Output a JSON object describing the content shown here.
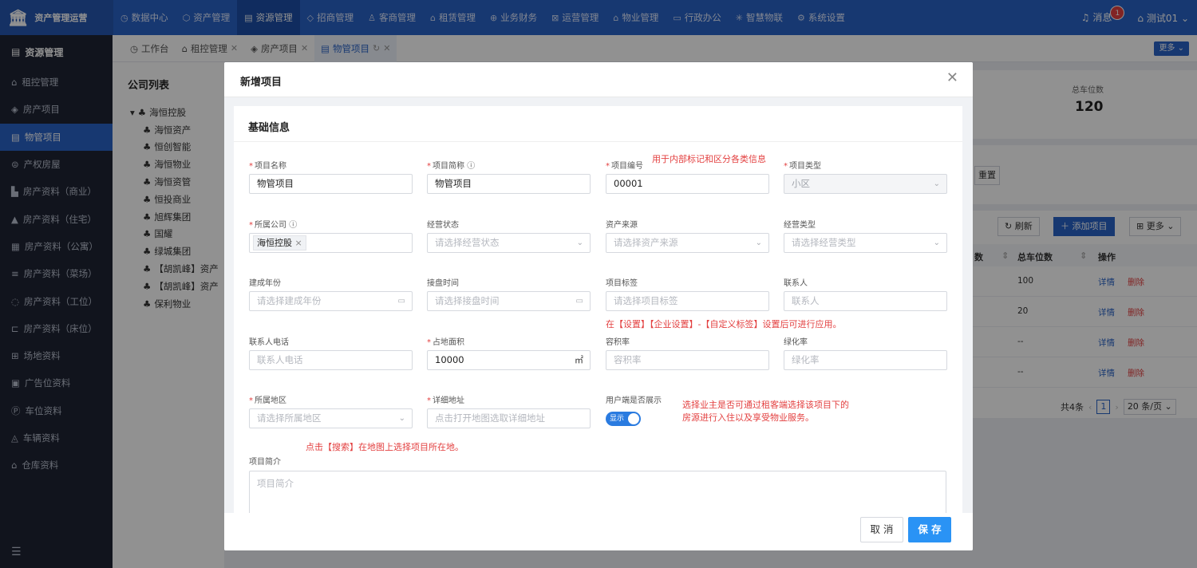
{
  "topbar": {
    "app_name": "资产管理运营",
    "nav": [
      {
        "label": "数据中心",
        "icon": "dashboard-icon",
        "glyph": "◷"
      },
      {
        "label": "资产管理",
        "icon": "cube-icon",
        "glyph": "⬡"
      },
      {
        "label": "资源管理",
        "icon": "document-icon",
        "glyph": "▤"
      },
      {
        "label": "招商管理",
        "icon": "tag-icon",
        "glyph": "◇"
      },
      {
        "label": "客商管理",
        "icon": "users-icon",
        "glyph": "♙"
      },
      {
        "label": "租赁管理",
        "icon": "building-icon",
        "glyph": "⌂"
      },
      {
        "label": "业务财务",
        "icon": "coin-icon",
        "glyph": "⊕"
      },
      {
        "label": "运营管理",
        "icon": "grid-icon",
        "glyph": "⊠"
      },
      {
        "label": "物业管理",
        "icon": "home-icon",
        "glyph": "⌂"
      },
      {
        "label": "行政办公",
        "icon": "monitor-icon",
        "glyph": "▭"
      },
      {
        "label": "智慧物联",
        "icon": "iot-icon",
        "glyph": "✳"
      },
      {
        "label": "系统设置",
        "icon": "gear-icon",
        "glyph": "⚙"
      }
    ],
    "messages_label": "消息",
    "messages_count": "1",
    "user_label": "测试01"
  },
  "sidebar": {
    "header": "资源管理",
    "items": [
      {
        "label": "租控管理",
        "glyph": "⌂"
      },
      {
        "label": "房产项目",
        "glyph": "◈"
      },
      {
        "label": "物管项目",
        "glyph": "▤"
      },
      {
        "label": "产权房屋",
        "glyph": "⊜"
      },
      {
        "label": "房产资料（商业）",
        "glyph": "▙"
      },
      {
        "label": "房产资料（住宅）",
        "glyph": "▲"
      },
      {
        "label": "房产资料（公寓）",
        "glyph": "▦"
      },
      {
        "label": "房产资料（菜场）",
        "glyph": "≡"
      },
      {
        "label": "房产资料（工位）",
        "glyph": "◌"
      },
      {
        "label": "房产资料（床位）",
        "glyph": "⊏"
      },
      {
        "label": "场地资料",
        "glyph": "⊞"
      },
      {
        "label": "广告位资料",
        "glyph": "▣"
      },
      {
        "label": "车位资料",
        "glyph": "Ⓟ"
      },
      {
        "label": "车辆资料",
        "glyph": "◬"
      },
      {
        "label": "仓库资料",
        "glyph": "⌂"
      }
    ]
  },
  "tabs": [
    {
      "label": "工作台",
      "glyph": "◷"
    },
    {
      "label": "租控管理",
      "glyph": "⌂"
    },
    {
      "label": "房产项目",
      "glyph": "◈"
    },
    {
      "label": "物管项目",
      "glyph": "▤"
    }
  ],
  "tabs_more": "更多 ⌄",
  "company": {
    "title": "公司列表",
    "root": "海恒控股",
    "children": [
      "海恒资产",
      "恒创智能",
      "海恒物业",
      "海恒资管",
      "恒投商业",
      "旭辉集团",
      "国耀",
      "绿城集团",
      "【胡凯峰】资产",
      "【胡凯峰】资产",
      "保利物业"
    ]
  },
  "stats": {
    "label": "总车位数",
    "value": "120"
  },
  "reset_label": "重置",
  "table": {
    "refresh": "刷新",
    "add": "添加项目",
    "more": "更多",
    "col_partial": "数",
    "col_total_parking": "总车位数",
    "col_actions": "操作",
    "rows": [
      {
        "parking": "100"
      },
      {
        "parking": "20"
      },
      {
        "parking": "--"
      },
      {
        "parking": "--"
      }
    ],
    "detail": "详情",
    "delete": "删除",
    "total": "共4条",
    "page": "1",
    "page_size": "20 条/页"
  },
  "modal": {
    "title": "新增项目",
    "section_title": "基础信息",
    "fields": {
      "name": {
        "label": "项目名称",
        "value": "物管项目"
      },
      "short": {
        "label": "项目简称",
        "value": "物管项目"
      },
      "code": {
        "label": "项目编号",
        "value": "00001"
      },
      "type": {
        "label": "项目类型",
        "value": "小区"
      },
      "company": {
        "label": "所属公司",
        "tag": "海恒控股"
      },
      "status": {
        "label": "经营状态",
        "placeholder": "请选择经营状态"
      },
      "source": {
        "label": "资产来源",
        "placeholder": "请选择资产来源"
      },
      "biz_type": {
        "label": "经营类型",
        "placeholder": "请选择经营类型"
      },
      "year": {
        "label": "建成年份",
        "placeholder": "请选择建成年份"
      },
      "takeover": {
        "label": "接盘时间",
        "placeholder": "请选择接盘时间"
      },
      "tags": {
        "label": "项目标签",
        "placeholder": "请选择项目标签"
      },
      "contact": {
        "label": "联系人",
        "placeholder": "联系人"
      },
      "phone": {
        "label": "联系人电话",
        "placeholder": "联系人电话"
      },
      "area": {
        "label": "占地面积",
        "value": "10000",
        "unit": "㎡"
      },
      "plot_ratio": {
        "label": "容积率",
        "placeholder": "容积率"
      },
      "green_ratio": {
        "label": "绿化率",
        "placeholder": "绿化率"
      },
      "region": {
        "label": "所属地区",
        "placeholder": "请选择所属地区"
      },
      "address": {
        "label": "详细地址",
        "placeholder": "点击打开地图选取详细地址"
      },
      "show": {
        "label": "用户端是否展示",
        "toggle": "显示"
      },
      "intro": {
        "label": "项目简介",
        "placeholder": "项目简介"
      }
    },
    "notes": {
      "code": "用于内部标记和区分各类信息",
      "tags": "在【设置】【企业设置】-【自定义标签】设置后可进行应用。",
      "show_line1": "选择业主是否可通过租客端选择该项目下的",
      "show_line2": "房源进行入住以及享受物业服务。",
      "map": "点击【搜索】在地图上选择项目所在地。"
    },
    "cancel": "取 消",
    "save": "保 存"
  },
  "colors": {
    "primary": "#2a63c7",
    "sidebar": "#1f2433",
    "danger": "#e34040",
    "save": "#2a93f5"
  }
}
